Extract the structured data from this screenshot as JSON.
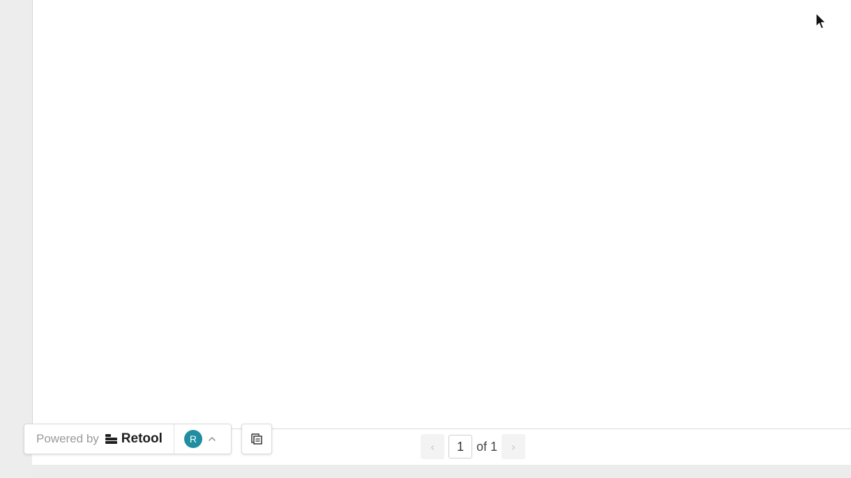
{
  "powered_by": {
    "label": "Powered by",
    "brand": "Retool",
    "avatar_initial": "R",
    "avatar_color": "#1f8ea0"
  },
  "pagination": {
    "prev_label": "‹",
    "current_page": "1",
    "of_label": "of 1",
    "next_label": "›"
  },
  "icons": {
    "logo": "retool-logo-icon",
    "caret": "chevron-up-icon",
    "copy": "copy-icon",
    "cursor": "mouse-cursor-icon"
  }
}
